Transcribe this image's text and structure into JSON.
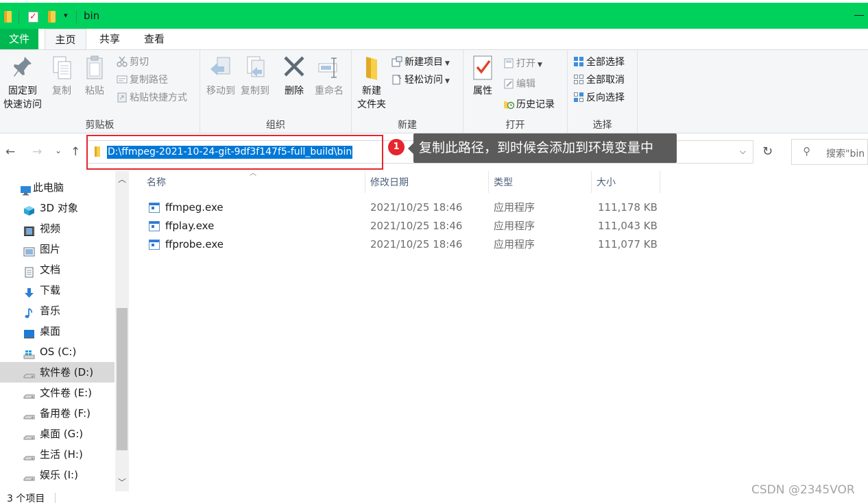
{
  "window": {
    "title": "bin"
  },
  "tabs": {
    "file": "文件",
    "home": "主页",
    "share": "共享",
    "view": "查看"
  },
  "ribbon": {
    "clipboard": {
      "group": "剪贴板",
      "pin_line1": "固定到",
      "pin_line2": "快速访问",
      "copy": "复制",
      "paste": "粘贴",
      "cut": "剪切",
      "copy_path": "复制路径",
      "paste_shortcut": "粘贴快捷方式"
    },
    "organize": {
      "group": "组织",
      "move_to": "移动到",
      "copy_to": "复制到",
      "delete": "删除",
      "rename": "重命名"
    },
    "new": {
      "group": "新建",
      "new_folder_line1": "新建",
      "new_folder_line2": "文件夹",
      "new_item": "新建项目",
      "easy_access": "轻松访问"
    },
    "open": {
      "group": "打开",
      "properties": "属性",
      "open": "打开",
      "edit": "编辑",
      "history": "历史记录"
    },
    "select": {
      "group": "选择",
      "select_all": "全部选择",
      "select_none": "全部取消",
      "invert": "反向选择"
    }
  },
  "address": {
    "path": "D:\\ffmpeg-2021-10-24-git-9df3f147f5-full_build\\bin"
  },
  "search": {
    "placeholder": "搜索\"bin"
  },
  "annotation": {
    "marker": "1",
    "text": "复制此路径，到时候会添加到环境变量中"
  },
  "navpane": {
    "items": [
      {
        "label": "此电脑"
      },
      {
        "label": "3D 对象"
      },
      {
        "label": "视频"
      },
      {
        "label": "图片"
      },
      {
        "label": "文档"
      },
      {
        "label": "下载"
      },
      {
        "label": "音乐"
      },
      {
        "label": "桌面"
      },
      {
        "label": "OS (C:)"
      },
      {
        "label": "软件卷 (D:)"
      },
      {
        "label": "文件卷 (E:)"
      },
      {
        "label": "备用卷 (F:)"
      },
      {
        "label": "桌面 (G:)"
      },
      {
        "label": "生活 (H:)"
      },
      {
        "label": "娱乐 (I:)"
      }
    ],
    "selected": "软件卷 (D:)"
  },
  "filelist": {
    "columns": {
      "name": "名称",
      "modified": "修改日期",
      "type": "类型",
      "size": "大小"
    },
    "rows": [
      {
        "name": "ffmpeg.exe",
        "modified": "2021/10/25 18:46",
        "type": "应用程序",
        "size": "111,178 KB"
      },
      {
        "name": "ffplay.exe",
        "modified": "2021/10/25 18:46",
        "type": "应用程序",
        "size": "111,043 KB"
      },
      {
        "name": "ffprobe.exe",
        "modified": "2021/10/25 18:46",
        "type": "应用程序",
        "size": "111,077 KB"
      }
    ]
  },
  "status": {
    "count": "3 个项目"
  },
  "watermark": "CSDN @2345VOR",
  "colors": {
    "titlebar": "#00d15d",
    "file_tab": "#00b852",
    "selection": "#0078d7",
    "annotation_red": "#e8242d"
  }
}
